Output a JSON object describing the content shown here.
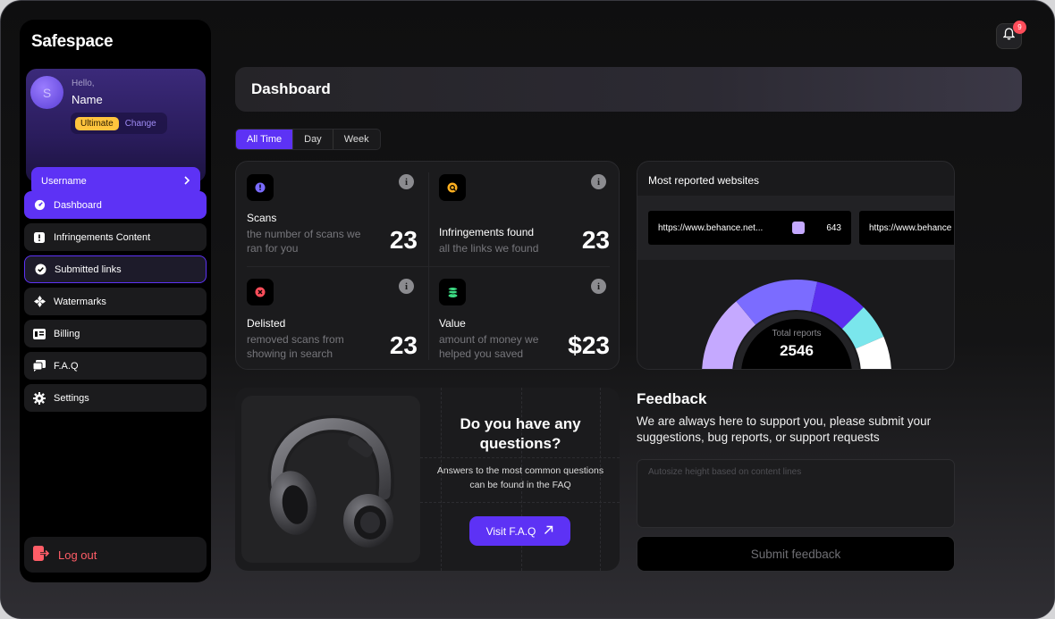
{
  "app": {
    "logo": "Safespace"
  },
  "profile": {
    "avatar_letter": "S",
    "greeting": "Hello,",
    "name": "Name",
    "plan": "Ultimate",
    "change_label": "Change",
    "username_button": "Username"
  },
  "nav": {
    "items": [
      {
        "label": "Dashboard",
        "icon": "dashboard-icon",
        "state": "active"
      },
      {
        "label": "Infringements  Content",
        "icon": "alert-icon",
        "state": ""
      },
      {
        "label": "Submitted links",
        "icon": "check-circle-icon",
        "state": "outlined"
      },
      {
        "label": "Watermarks",
        "icon": "watermark-icon",
        "state": ""
      },
      {
        "label": "Billing",
        "icon": "billing-icon",
        "state": ""
      },
      {
        "label": "F.A.Q",
        "icon": "faq-icon",
        "state": ""
      },
      {
        "label": "Settings",
        "icon": "gear-icon",
        "state": ""
      }
    ],
    "logout": "Log out"
  },
  "header": {
    "title": "Dashboard",
    "notifications_count": "9"
  },
  "time_filter": {
    "options": [
      "All Time",
      "Day",
      "Week"
    ],
    "selected": "All Time"
  },
  "stats": [
    {
      "title": "Scans",
      "desc": "the number of scans we ran for you",
      "value": "23",
      "icon": "scan-icon",
      "icon_color": "#7a6bff"
    },
    {
      "title": "Infringements found",
      "desc": "all the links we found",
      "value": "23",
      "icon": "search-alert-icon",
      "icon_color": "#ffb020"
    },
    {
      "title": "Delisted",
      "desc": "removed scans from showing in search",
      "value": "23",
      "icon": "close-circle-icon",
      "icon_color": "#ff4d5a"
    },
    {
      "title": "Value",
      "desc": "amount of money we helped you saved",
      "value": "$23",
      "icon": "coins-icon",
      "icon_color": "#3ddc84"
    }
  ],
  "reported": {
    "title": "Most reported websites",
    "sites": [
      {
        "url": "https://www.behance.net...",
        "count": "643"
      },
      {
        "url": "https://www.behance"
      }
    ],
    "total_label": "Total reports",
    "total_value": "2546",
    "segments": [
      {
        "color": "#c5a9ff",
        "fraction": 0.28
      },
      {
        "color": "#7b6cff",
        "fraction": 0.29
      },
      {
        "color": "#5b2ff0",
        "fraction": 0.18
      },
      {
        "color": "#7ae6ec",
        "fraction": 0.12
      },
      {
        "color": "#ffffff",
        "fraction": 0.13
      }
    ]
  },
  "faq": {
    "title": "Do you have any questions?",
    "desc": "Answers to the most common questions can be found in the FAQ",
    "button": "Visit F.A.Q"
  },
  "feedback": {
    "title": "Feedback",
    "desc": "We are always here to support you, please submit your suggestions, bug reports, or support requests",
    "placeholder": "Autosize height based on content lines",
    "submit": "Submit feedback"
  }
}
